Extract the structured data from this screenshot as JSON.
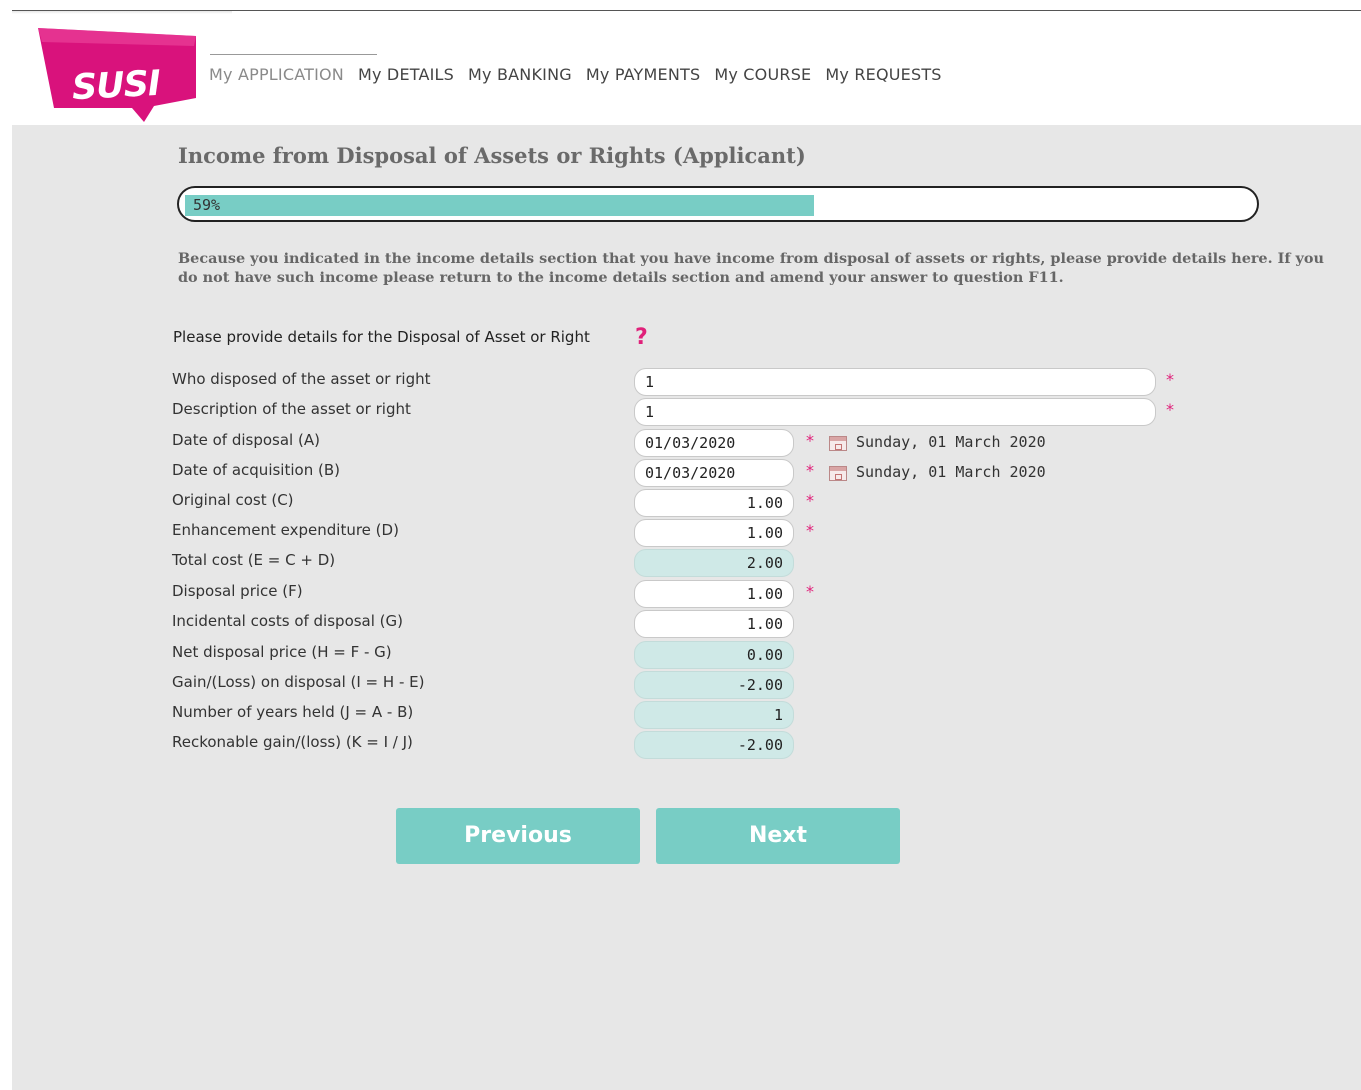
{
  "brand": {
    "logo_text": "SUSI",
    "accent": "#e0217a",
    "teal": "#78cdc5"
  },
  "nav": {
    "items": [
      {
        "label": "My APPLICATION",
        "active": true
      },
      {
        "label": "My DETAILS"
      },
      {
        "label": "My BANKING"
      },
      {
        "label": "My PAYMENTS"
      },
      {
        "label": "My COURSE"
      },
      {
        "label": "My REQUESTS"
      }
    ]
  },
  "page": {
    "title": "Income from Disposal of Assets or Rights (Applicant)",
    "progress": {
      "value": 59,
      "label": "59%"
    },
    "intro": "Because you indicated in the income details section that you have income from disposal of assets or rights, please provide details here. If you do not have such income please return to the income details section and amend your answer to question F11.",
    "section_label": "Please provide details for the Disposal of Asset or Right",
    "help_icon": "?"
  },
  "form": {
    "rows": [
      {
        "label": "Who disposed of the asset or right",
        "value": "1",
        "required": true
      },
      {
        "label": "Description of the asset or right",
        "value": "1",
        "required": true
      },
      {
        "label": "Date of disposal (A)",
        "value": "01/03/2020",
        "required": true,
        "date_text": "Sunday, 01 March 2020"
      },
      {
        "label": "Date of acquisition (B)",
        "value": "01/03/2020",
        "required": true,
        "date_text": "Sunday, 01 March 2020"
      },
      {
        "label": "Original cost (C)",
        "value": "1.00",
        "required": true
      },
      {
        "label": "Enhancement expenditure (D)",
        "value": "1.00",
        "required": true
      },
      {
        "label": "Total cost (E = C + D)",
        "value": "2.00",
        "calculated": true
      },
      {
        "label": "Disposal price (F)",
        "value": "1.00",
        "required": true
      },
      {
        "label": "Incidental costs of disposal (G)",
        "value": "1.00"
      },
      {
        "label": "Net disposal price (H = F - G)",
        "value": "0.00",
        "calculated": true
      },
      {
        "label": "Gain/(Loss) on disposal (I = H - E)",
        "value": "-2.00",
        "calculated": true
      },
      {
        "label": "Number of years held (J = A - B)",
        "value": "1",
        "calculated": true
      },
      {
        "label": "Reckonable gain/(loss) (K = I / J)",
        "value": "-2.00",
        "calculated": true
      }
    ],
    "required_mark": "*"
  },
  "buttons": {
    "previous": "Previous",
    "next": "Next"
  }
}
